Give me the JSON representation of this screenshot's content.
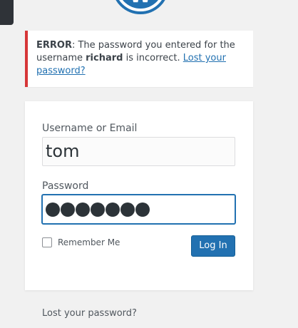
{
  "notice": {
    "prefix": "ERROR",
    "text_1": ": The password you entered for the username ",
    "username": "richard",
    "text_2": " is incorrect. ",
    "link": "Lost your password?"
  },
  "form": {
    "username_label": "Username or Email",
    "username_value": "tom",
    "password_label": "Password",
    "password_dots": 7,
    "remember_label": "Remember Me",
    "login_button": "Log In"
  },
  "footer": {
    "lost_password": "Lost your password?"
  },
  "colors": {
    "accent": "#2271b1",
    "error": "#d63638",
    "background": "#f1f1f1"
  }
}
